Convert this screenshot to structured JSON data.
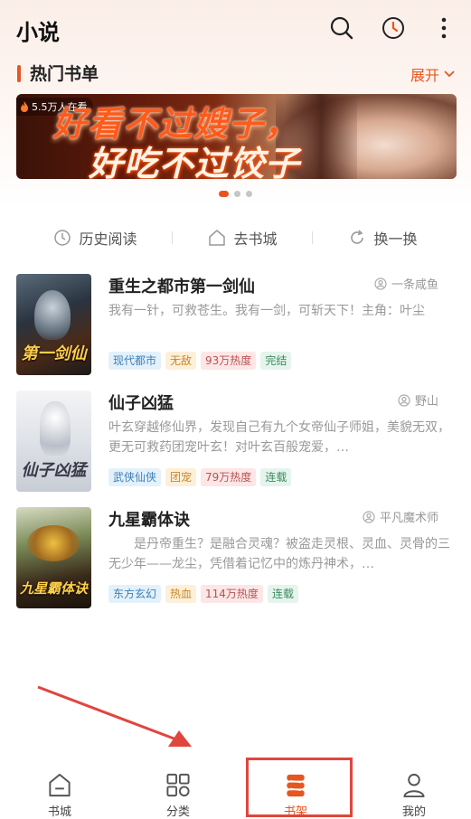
{
  "app": {
    "title": "小说"
  },
  "header_icons": [
    "search-icon",
    "history-clock-icon",
    "more-vertical-icon"
  ],
  "section": {
    "title": "热门书单",
    "expand_label": "展开"
  },
  "banner": {
    "badge": "5.5万人在看",
    "line1": "好看不过嫂子，",
    "line2": "好吃不过饺子"
  },
  "carousel": {
    "count": 3,
    "active_index": 0
  },
  "quick_actions": [
    {
      "label": "历史阅读",
      "icon": "clock-icon"
    },
    {
      "label": "去书城",
      "icon": "home-icon"
    },
    {
      "label": "换一换",
      "icon": "refresh-icon"
    }
  ],
  "books": [
    {
      "title": "重生之都市第一剑仙",
      "author": "一条咸鱼",
      "description": "我有一针，可救苍生。我有一剑，可斩天下！主角：叶尘",
      "cover_text": "第一剑仙",
      "tags": [
        {
          "label": "现代都市",
          "style": "blue"
        },
        {
          "label": "无敌",
          "style": "yellow"
        },
        {
          "label": "93万热度",
          "style": "pink"
        },
        {
          "label": "完结",
          "style": "green"
        }
      ]
    },
    {
      "title": "仙子凶猛",
      "author": "野山",
      "description": "叶玄穿越修仙界，发现自己有九个女帝仙子师姐，美貌无双，更无可救药团宠叶玄！对叶玄百般宠爱，…",
      "cover_text": "仙子凶猛",
      "tags": [
        {
          "label": "武侠仙侠",
          "style": "blue"
        },
        {
          "label": "团宠",
          "style": "yellow"
        },
        {
          "label": "79万热度",
          "style": "pink"
        },
        {
          "label": "连载",
          "style": "green"
        }
      ]
    },
    {
      "title": "九星霸体诀",
      "author": "平凡魔术师",
      "description": "是丹帝重生？是融合灵魂？被盗走灵根、灵血、灵骨的三无少年——龙尘，凭借着记忆中的炼丹神术，…",
      "cover_text": "九星霸体诀",
      "tags": [
        {
          "label": "东方玄幻",
          "style": "blue"
        },
        {
          "label": "热血",
          "style": "yellow"
        },
        {
          "label": "114万热度",
          "style": "pink"
        },
        {
          "label": "连载",
          "style": "green"
        }
      ]
    }
  ],
  "tabbar": [
    {
      "label": "书城",
      "icon": "bookstore-icon",
      "active": false
    },
    {
      "label": "分类",
      "icon": "category-grid-icon",
      "active": false
    },
    {
      "label": "书架",
      "icon": "bookshelf-icon",
      "active": true
    },
    {
      "label": "我的",
      "icon": "user-icon",
      "active": false
    }
  ],
  "colors": {
    "accent": "#e8551f",
    "annotation": "#e0463e"
  }
}
